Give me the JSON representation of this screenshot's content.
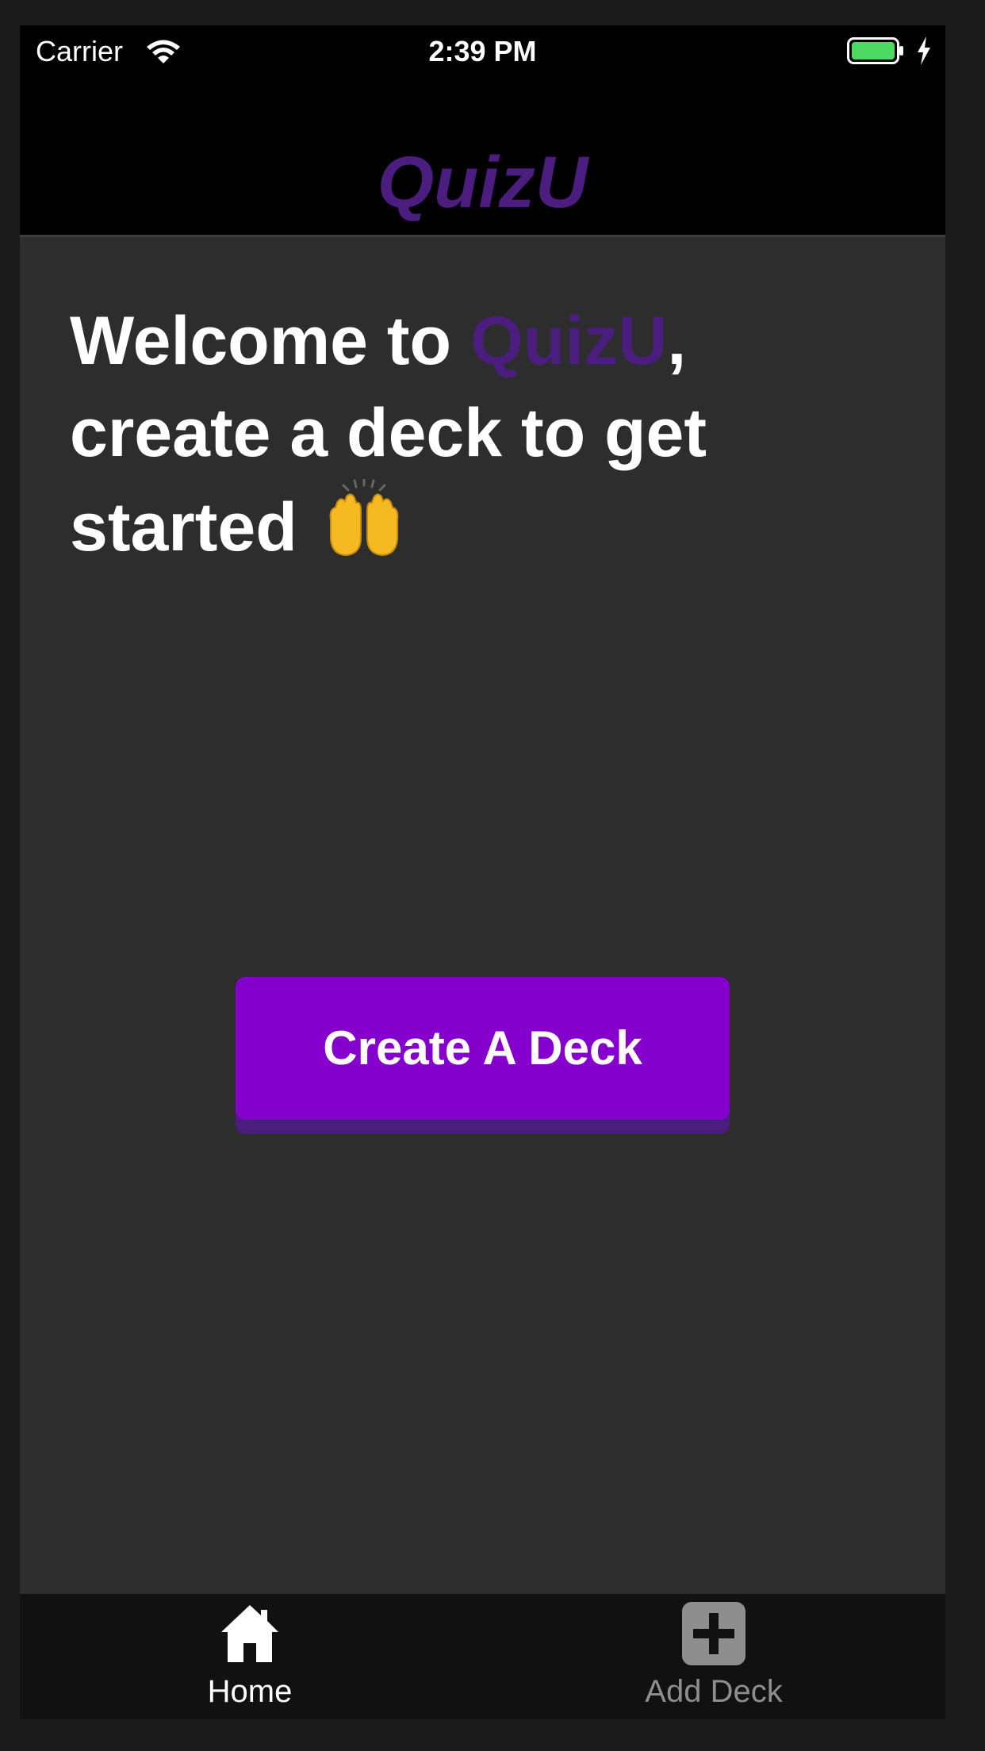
{
  "status_bar": {
    "carrier": "Carrier",
    "time": "2:39 PM",
    "wifi_icon": "wifi-icon",
    "battery_icon": "battery-icon",
    "charging_icon": "bolt-icon",
    "battery_color": "#4cd964"
  },
  "header": {
    "title": "QuizU",
    "title_color": "#4b1d7e"
  },
  "welcome": {
    "line_prefix": "Welcome to ",
    "brand": "QuizU",
    "line_suffix": ", create a deck to get started",
    "emoji_icon": "raising-hands-icon",
    "brand_color": "#4b1d7e",
    "text_color": "#ffffff"
  },
  "main": {
    "create_button_label": "Create A Deck",
    "button_color": "#8500cc",
    "button_shadow_color": "#4b1d7e"
  },
  "tab_bar": {
    "tabs": [
      {
        "label": "Home",
        "icon": "home-icon",
        "active": true,
        "color": "#ffffff"
      },
      {
        "label": "Add Deck",
        "icon": "plus-square-icon",
        "active": false,
        "color": "#8e8e8e"
      }
    ]
  },
  "theme": {
    "background": "#2d2d2d",
    "header_background": "#000000",
    "tab_bar_background": "#111111"
  }
}
